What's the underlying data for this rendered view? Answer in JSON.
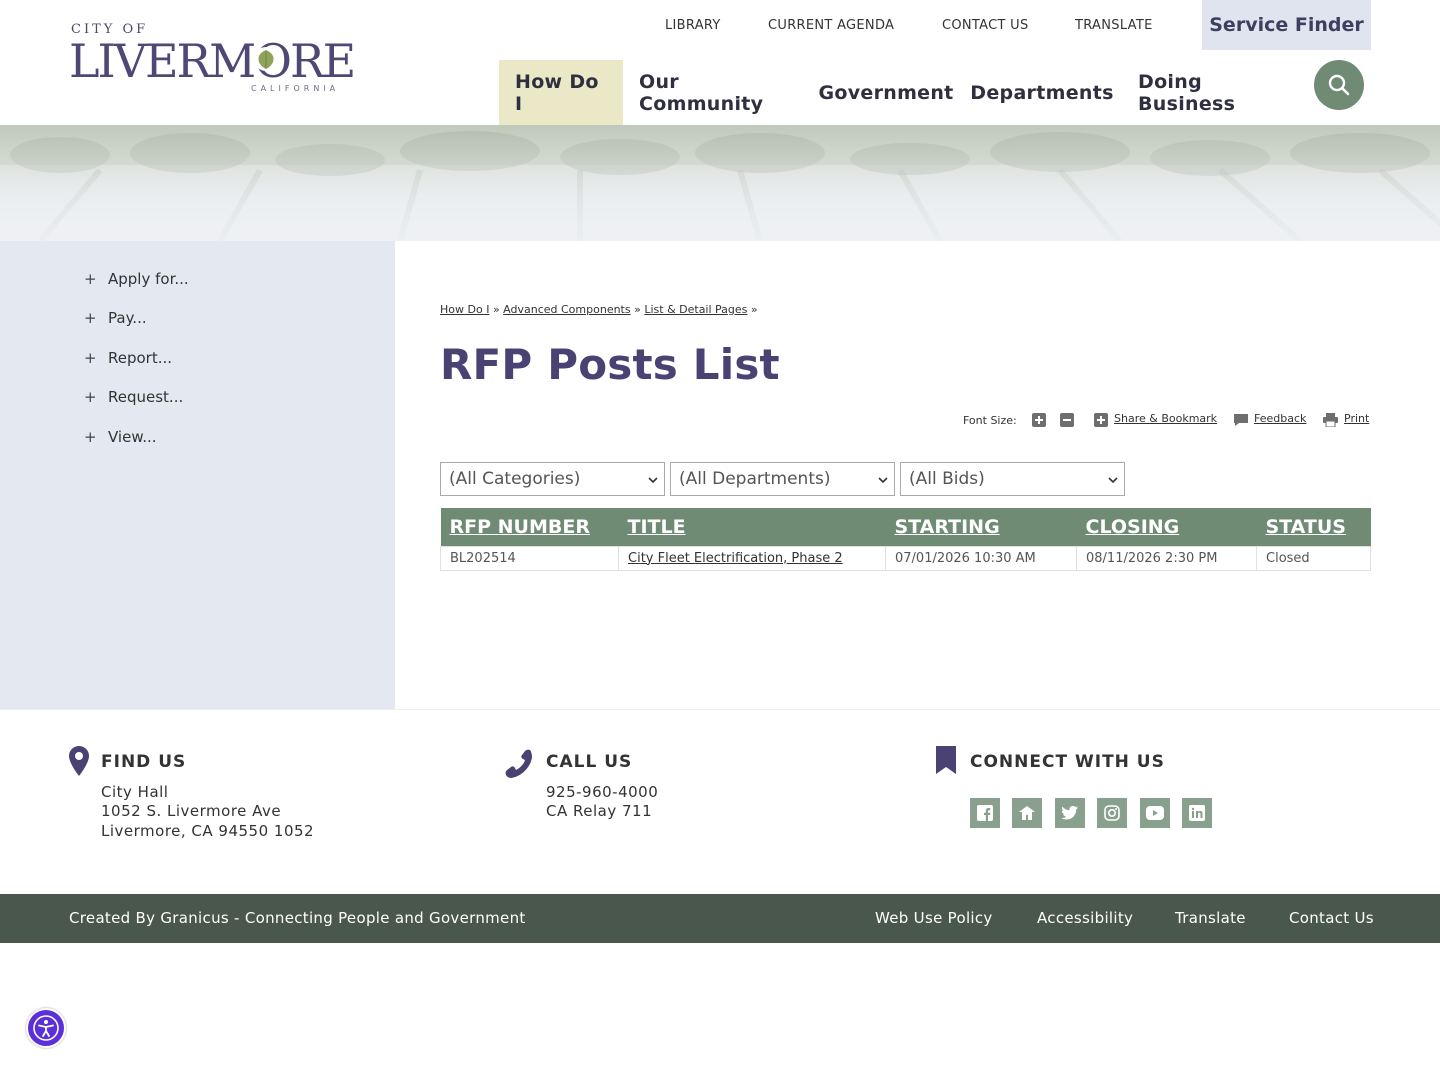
{
  "logo": {
    "city_of": "CITY OF",
    "name": "LIVERMORE",
    "state": "CALIFORNIA"
  },
  "utility_nav": [
    "LIBRARY",
    "CURRENT AGENDA",
    "CONTACT US",
    "TRANSLATE"
  ],
  "service_finder": "Service Finder",
  "main_nav": [
    "How Do I",
    "Our Community",
    "Government",
    "Departments",
    "Doing Business"
  ],
  "main_nav_active": "How Do I",
  "search_icon": "search-icon",
  "sidebar": {
    "items": [
      "Apply for...",
      "Pay...",
      "Report...",
      "Request...",
      "View..."
    ]
  },
  "breadcrumb": {
    "items": [
      "How Do I",
      "Advanced Components",
      "List & Detail Pages"
    ],
    "separator": "»"
  },
  "page_title": "RFP Posts List",
  "tools": {
    "font_size_label": "Font Size:",
    "share": "Share & Bookmark",
    "feedback": "Feedback",
    "print": "Print"
  },
  "filters": {
    "categories": "(All Categories)",
    "departments": "(All Departments)",
    "bids": "(All Bids)"
  },
  "table": {
    "headers": [
      "RFP NUMBER",
      "TITLE",
      "STARTING",
      "CLOSING",
      "STATUS"
    ],
    "rows": [
      [
        "BL202514",
        "City Fleet Electrification, Phase 2",
        "07/01/2026 10:30 AM",
        "08/11/2026 2:30 PM",
        "Closed"
      ]
    ]
  },
  "footer": {
    "find_us": {
      "heading": "FIND US",
      "lines": [
        "City Hall",
        "1052 S. Livermore Ave",
        "Livermore, CA 94550 1052"
      ]
    },
    "call_us": {
      "heading": "CALL US",
      "lines": [
        "925-960-4000",
        "CA Relay 711"
      ]
    },
    "connect": {
      "heading": "CONNECT WITH US",
      "icons": [
        "facebook-icon",
        "nextdoor-icon",
        "twitter-icon",
        "instagram-icon",
        "youtube-icon",
        "linkedin-icon"
      ]
    }
  },
  "footer_bar": {
    "credit": "Created By Granicus - Connecting People and Government",
    "links": [
      "Web Use Policy",
      "Accessibility",
      "Translate",
      "Contact Us"
    ]
  },
  "colors": {
    "accent_green": "#6f8b74",
    "title_purple": "#4a4272",
    "active_nav": "#ebe8c7",
    "sidebar_bg": "#e4e9f1",
    "footer_bar": "#4a574d",
    "a11y_button": "#5b2fd9"
  }
}
